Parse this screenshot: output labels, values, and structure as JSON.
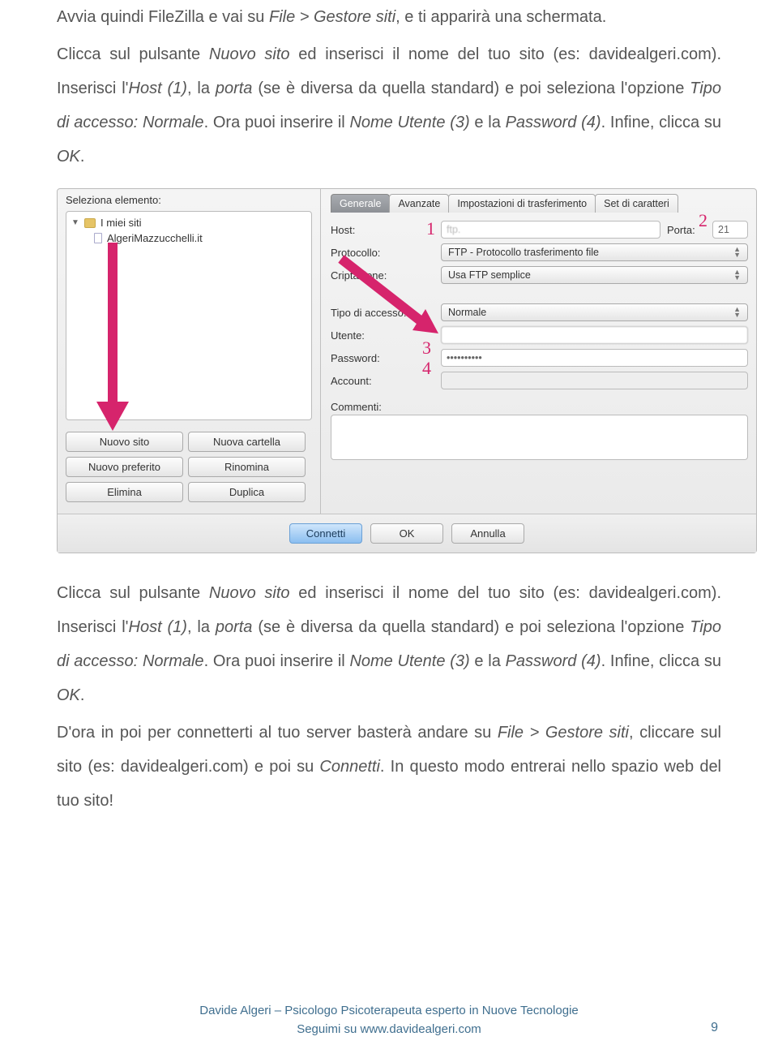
{
  "para1_a": "Avvia quindi FileZilla e vai su ",
  "para1_b": "File > Gestore siti",
  "para1_c": ", e ti apparirà una schermata.",
  "para2_a": "Clicca sul pulsante ",
  "para2_b": "Nuovo sito",
  "para2_c": " ed inserisci il nome del tuo sito (es: davidealgeri.com). Inserisci l'",
  "para2_d": "Host (1)",
  "para2_e": ", la ",
  "para2_f": "porta",
  "para2_g": " (se è diversa da quella standard) e poi seleziona l'opzione ",
  "para2_h": "Tipo di accesso: Normale",
  "para2_i": ". Ora puoi inserire il ",
  "para2_j": "Nome Utente (3)",
  "para2_k": " e la ",
  "para2_l": "Password (4)",
  "para2_m": ". Infine, clicca su ",
  "para2_n": "OK",
  "para2_o": ".",
  "para3_a": "Clicca sul pulsante ",
  "para3_b": "Nuovo sito",
  "para3_c": " ed inserisci il nome del tuo sito (es: davidealgeri.com). Inserisci l'",
  "para3_d": "Host (1)",
  "para3_e": ", la ",
  "para3_f": "porta",
  "para3_g": " (se è diversa da quella standard) e poi seleziona l'opzione ",
  "para3_h": "Tipo di accesso: Normale",
  "para3_i": ". Ora puoi inserire il ",
  "para3_j": "Nome Utente (3)",
  "para3_k": " e la ",
  "para3_l": "Password (4)",
  "para3_m": ". Infine, clicca su ",
  "para3_n": "OK",
  "para3_o": ".",
  "para4_a": "D'ora in poi per connetterti al tuo server basterà andare su ",
  "para4_b": "File > Gestore siti",
  "para4_c": ", cliccare sul sito (es: davidealgeri.com) e poi su ",
  "para4_d": "Connetti",
  "para4_e": ". In questo modo entrerai nello spazio web del tuo sito!",
  "shot": {
    "sel_label": "Seleziona elemento:",
    "tree_root": "I miei siti",
    "tree_item": "AlgeriMazzucchelli.it",
    "btn_nuovo_sito": "Nuovo sito",
    "btn_nuova_cartella": "Nuova cartella",
    "btn_nuovo_preferito": "Nuovo preferito",
    "btn_rinomina": "Rinomina",
    "btn_elimina": "Elimina",
    "btn_duplica": "Duplica",
    "tab_generale": "Generale",
    "tab_avanzate": "Avanzate",
    "tab_impost": "Impostazioni di trasferimento",
    "tab_set": "Set di caratteri",
    "lbl_host": "Host:",
    "val_host": "ftp.",
    "lbl_porta": "Porta:",
    "val_porta": "21",
    "lbl_protocollo": "Protocollo:",
    "val_protocollo": "FTP - Protocollo trasferimento file",
    "lbl_criptazione": "Criptazione:",
    "val_criptazione": "Usa FTP semplice",
    "lbl_tipo": "Tipo di accesso:",
    "val_tipo": "Normale",
    "lbl_utente": "Utente:",
    "val_utente": " ",
    "lbl_password": "Password:",
    "val_password": "••••••••••",
    "lbl_account": "Account:",
    "lbl_commenti": "Commenti:",
    "btn_connetti": "Connetti",
    "btn_ok": "OK",
    "btn_annulla": "Annulla",
    "anno1": "1",
    "anno2": "2",
    "anno3": "3",
    "anno4": "4"
  },
  "footer_line1": "Davide Algeri – Psicologo Psicoterapeuta esperto in Nuove Tecnologie",
  "footer_line2": "Seguimi su www.davidealgeri.com",
  "page_number": "9"
}
